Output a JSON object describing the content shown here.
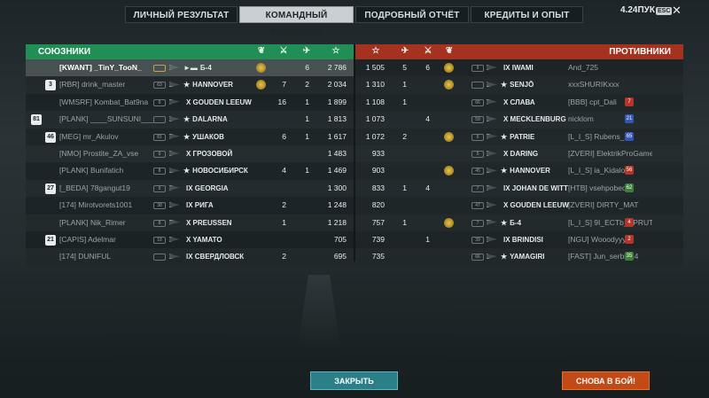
{
  "tabs": [
    {
      "label": "ЛИЧНЫЙ РЕЗУЛЬТАТ",
      "active": false
    },
    {
      "label": "КОМАНДНЫЙ РЕЗУЛЬТАТ",
      "active": true
    },
    {
      "label": "ПОДРОБНЫЙ ОТЧЁТ",
      "active": false
    },
    {
      "label": "КРЕДИТЫ И ОПЫТ",
      "active": false
    }
  ],
  "header": {
    "points": "4.24ПУК",
    "esc": "ESC",
    "close": "✕"
  },
  "colors": {
    "allies": "#1f8f55",
    "enemies": "#a5321f",
    "close_button": "#2b7f88",
    "again_button": "#c24a16"
  },
  "allies": {
    "title": "СОЮЗНИКИ",
    "column_icons": [
      "laurel-icon",
      "sword-icon",
      "plane-icon",
      "star-icon"
    ],
    "rows": [
      {
        "rank": "",
        "player": "[KWANT] _TinY_TooN_",
        "level": "",
        "ship": "Б-4",
        "ship_mark": "►▬",
        "medal": true,
        "kills": "",
        "planes": "6",
        "score": "2 786",
        "me": true
      },
      {
        "rank": "3",
        "player": "[RBR] drink_master",
        "level": "63",
        "ship": "HANNOVER",
        "ship_mark": "★",
        "medal": true,
        "kills": "7",
        "planes": "2",
        "score": "2 034"
      },
      {
        "rank": "",
        "player": "[WMSRF] Kombat_Bat9na",
        "level": "9",
        "ship": "X GOUDEN LEEUW",
        "ship_mark": "",
        "medal": false,
        "kills": "16",
        "planes": "1",
        "score": "1 899"
      },
      {
        "rank": "81",
        "player": "[PLANK] ____SUNSUNI___",
        "level": "",
        "ship": "DALARNA",
        "ship_mark": "★",
        "medal": false,
        "kills": "",
        "planes": "1",
        "score": "1 813"
      },
      {
        "rank": "46",
        "player": "[MEG] mr_Akulov",
        "level": "81",
        "ship": "УШАКОВ",
        "ship_mark": "★",
        "medal": false,
        "kills": "6",
        "planes": "1",
        "score": "1 617"
      },
      {
        "rank": "",
        "player": "[NMO] Prostite_ZA_vse",
        "level": "9",
        "ship": "X ГРОЗОВОЙ",
        "ship_mark": "",
        "medal": false,
        "kills": "",
        "planes": "",
        "score": "1 483"
      },
      {
        "rank": "",
        "player": "[PLANK] Bunifatich",
        "level": "8",
        "ship": "НОВОСИБИРСК",
        "ship_mark": "★",
        "medal": false,
        "kills": "4",
        "planes": "1",
        "score": "1 469"
      },
      {
        "rank": "27",
        "player": "[_BEDA] 78gangut19",
        "level": "9",
        "ship": "IX GEORGIA",
        "ship_mark": "",
        "medal": false,
        "kills": "",
        "planes": "",
        "score": "1 300"
      },
      {
        "rank": "",
        "player": "[174] Mirotvorets1001",
        "level": "38",
        "ship": "IX РИГА",
        "ship_mark": "",
        "medal": false,
        "kills": "2",
        "planes": "",
        "score": "1 248"
      },
      {
        "rank": "",
        "player": "[PLANK] Nik_Rimer",
        "level": "8",
        "ship": "X PREUSSEN",
        "ship_mark": "",
        "medal": false,
        "kills": "1",
        "planes": "",
        "score": "1 218"
      },
      {
        "rank": "21",
        "player": "[CAPIS] Adelmar",
        "level": "18",
        "ship": "X YAMATO",
        "ship_mark": "",
        "medal": false,
        "kills": "",
        "planes": "",
        "score": "705"
      },
      {
        "rank": "",
        "player": "[174] DUNIFUL",
        "level": "",
        "ship": "IX СВЕРДЛОВСК",
        "ship_mark": "",
        "medal": false,
        "kills": "2",
        "planes": "",
        "score": "695"
      }
    ]
  },
  "enemies": {
    "title": "ПРОТИВНИКИ",
    "column_icons": [
      "star-icon",
      "plane-icon",
      "sword-icon",
      "laurel-icon"
    ],
    "rows": [
      {
        "score": "1 505",
        "planes": "5",
        "kills": "6",
        "medal": true,
        "level": "9",
        "ship": "IX IWAMI",
        "ship_mark": "",
        "player": "And_725",
        "rank": ""
      },
      {
        "score": "1 310",
        "planes": "1",
        "kills": "",
        "medal": true,
        "level": "",
        "ship": "SENJŌ",
        "ship_mark": "★",
        "player": "xxxSHURIKxxx",
        "rank": ""
      },
      {
        "score": "1 108",
        "planes": "1",
        "kills": "",
        "medal": false,
        "level": "66",
        "ship": "X СЛАВА",
        "ship_mark": "",
        "player": "[BBB] cpt_Dali",
        "rank": "7"
      },
      {
        "score": "1 073",
        "planes": "",
        "kills": "4",
        "medal": false,
        "level": "59",
        "ship": "X MECKLENBURG",
        "ship_mark": "",
        "player": "nicklom",
        "rank": "21"
      },
      {
        "score": "1 072",
        "planes": "2",
        "kills": "",
        "medal": true,
        "level": "6",
        "ship": "PATRIE",
        "ship_mark": "★",
        "player": "[L_I_S] Rubens_",
        "rank": "65"
      },
      {
        "score": "933",
        "planes": "",
        "kills": "",
        "medal": false,
        "level": "5",
        "ship": "X DARING",
        "ship_mark": "",
        "player": "[ZVERI] ElektrikProGames",
        "rank": ""
      },
      {
        "score": "903",
        "planes": "",
        "kills": "",
        "medal": true,
        "level": "45",
        "ship": "HANNOVER",
        "ship_mark": "★",
        "player": "[L_I_S] ia_Kidaloff",
        "rank": "56"
      },
      {
        "score": "833",
        "planes": "1",
        "kills": "4",
        "medal": false,
        "level": "7",
        "ship": "IX JOHAN DE WITT",
        "ship_mark": "",
        "player": "[HTB] vsehpobedu",
        "rank": "62"
      },
      {
        "score": "820",
        "planes": "",
        "kills": "",
        "medal": false,
        "level": "47",
        "ship": "X GOUDEN LEEUW",
        "ship_mark": "",
        "player": "[ZVERI] DIRTY_MAT",
        "rank": ""
      },
      {
        "score": "757",
        "planes": "1",
        "kills": "",
        "medal": true,
        "level": "7",
        "ship": "Б-4",
        "ship_mark": "★",
        "player": "[L_I_S] 9I_ECTb_SPRUT",
        "rank": "4"
      },
      {
        "score": "739",
        "planes": "",
        "kills": "1",
        "medal": false,
        "level": "39",
        "ship": "IX BRINDISI",
        "ship_mark": "",
        "player": "[NGU] Wooodyyy",
        "rank": "2"
      },
      {
        "score": "735",
        "planes": "",
        "kills": "",
        "medal": false,
        "level": "66",
        "ship": "YAMAGIRI",
        "ship_mark": "★",
        "player": "[FAST] Jun_serbin24",
        "rank": "35"
      }
    ]
  },
  "buttons": {
    "close": "ЗАКРЫТЬ",
    "again": "СНОВА В БОЙ!"
  }
}
